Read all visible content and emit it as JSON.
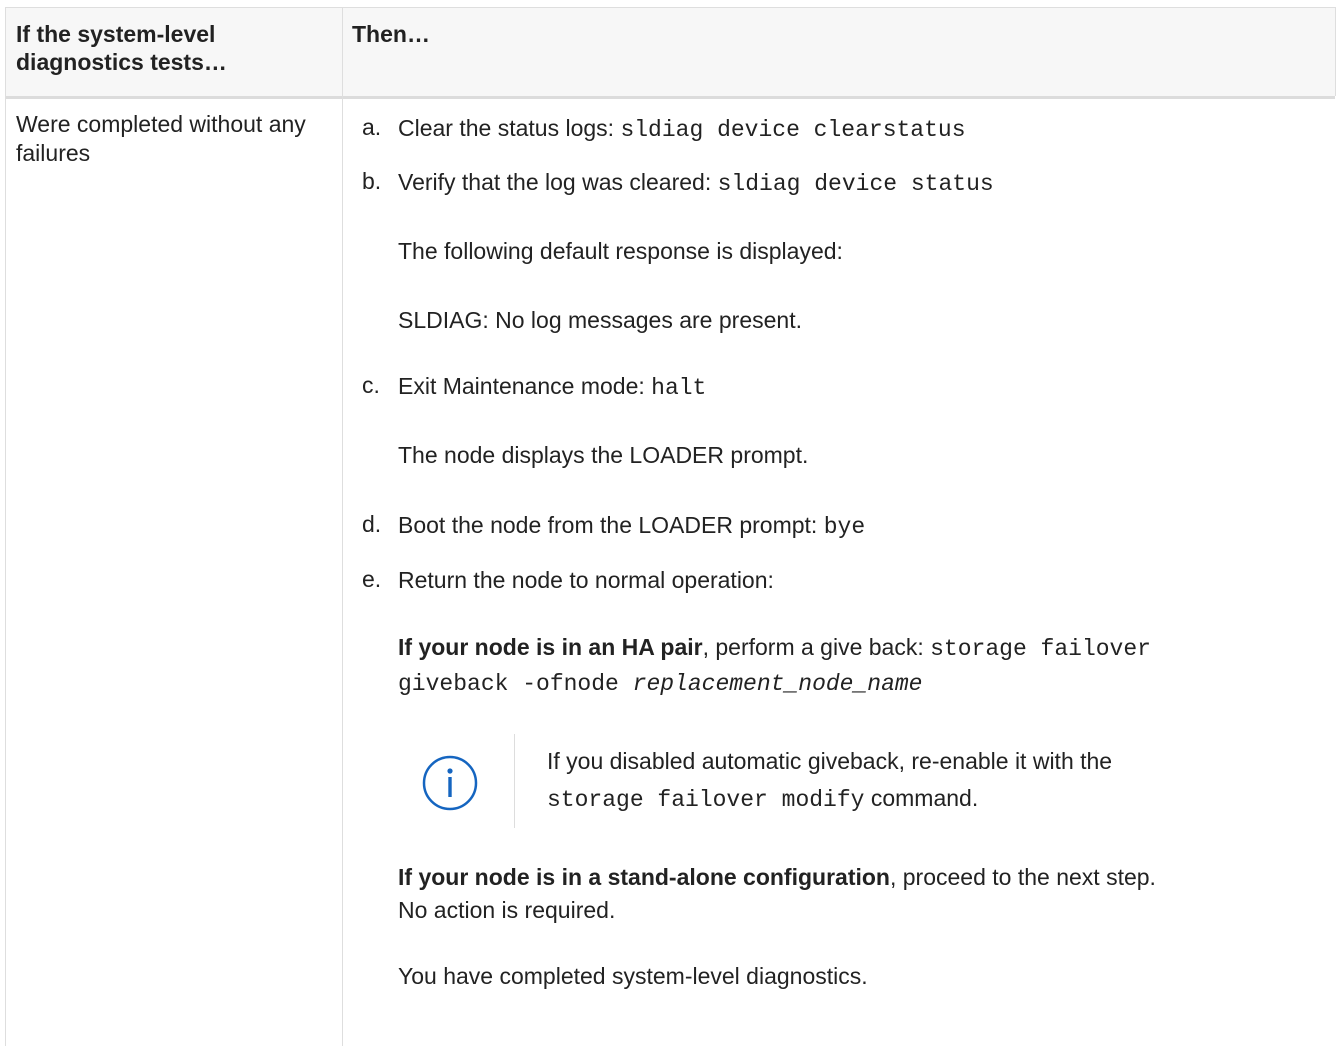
{
  "table": {
    "header": {
      "col1": "If the system-level diagnostics tests…",
      "col2": "Then…"
    },
    "row": {
      "condition": "Were completed without any failures",
      "steps": [
        {
          "marker": "a.",
          "text": "Clear the status logs: ",
          "code": "sldiag device clearstatus"
        },
        {
          "marker": "b.",
          "text": "Verify that the log was cleared: ",
          "code": "sldiag device status"
        },
        {
          "marker": "c.",
          "text": "Exit Maintenance mode: ",
          "code": "halt"
        },
        {
          "marker": "d.",
          "text": "Boot the node from the LOADER prompt: ",
          "code": "bye"
        },
        {
          "marker": "e.",
          "text": "Return the node to normal operation:"
        }
      ],
      "b_followup1": "The following default response is displayed:",
      "b_followup2": "SLDIAG: No log messages are present.",
      "c_followup": "The node displays the LOADER prompt.",
      "ha": {
        "bold": "If your node is in an HA pair",
        "text": ", perform a give back: ",
        "code1": "storage failover",
        "code2": "giveback -ofnode ",
        "code_italic": "replacement_node_name"
      },
      "note": {
        "icon": "info-circle-icon",
        "line1": "If you disabled automatic giveback, re-enable it with the",
        "code": "storage failover modify",
        "line2_suffix": " command."
      },
      "standalone": {
        "bold": "If your node is in a stand-alone configuration",
        "text": ", proceed to the next step.",
        "line2": "No action is required."
      },
      "final": "You have completed system-level diagnostics."
    }
  },
  "colors": {
    "text": "#222222",
    "header_bg": "#f7f7f7",
    "border": "#dedede",
    "info_icon": "#1565c0"
  }
}
